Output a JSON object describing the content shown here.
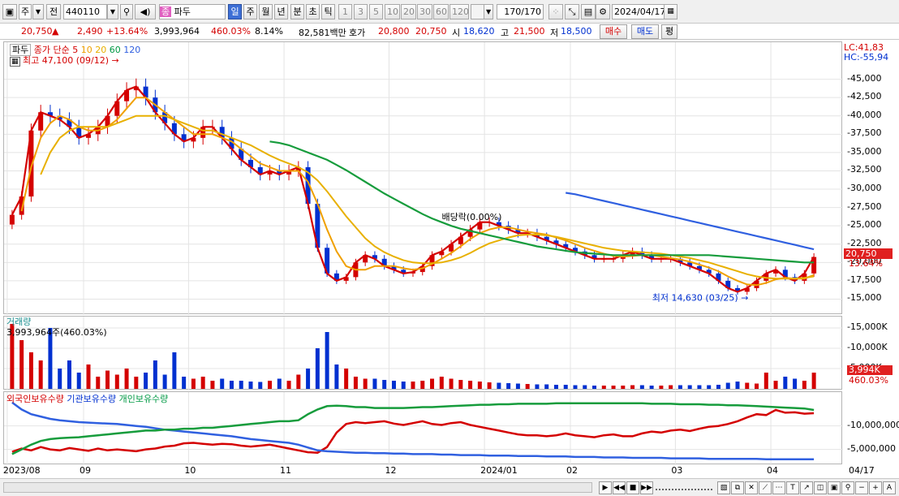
{
  "toolbar": {
    "period_main": "주",
    "prev_label": "전",
    "code": "440110",
    "type_badge": "종",
    "name": "파두",
    "periods": [
      "일",
      "주",
      "월",
      "년",
      "분",
      "초",
      "틱"
    ],
    "active_period": "일",
    "intervals": [
      "1",
      "3",
      "5",
      "10",
      "20",
      "30",
      "60",
      "120"
    ],
    "count": "170",
    "count_total": "/170",
    "date": "2024/04/17"
  },
  "quote": {
    "price": "20,750",
    "change_arrow": "▲",
    "change": "2,490",
    "change_pct": "+13.64%",
    "volume": "3,993,964",
    "volume_ratio": "460.03%",
    "turnover": "8.14%",
    "amount": "82,581백만",
    "ask_label": "호가",
    "ask": "20,800",
    "bid": "20,750",
    "open_label": "시",
    "open": "18,620",
    "high_label": "고",
    "high": "21,500",
    "low_label": "저",
    "low": "18,500",
    "buy_label": "매수",
    "sell_label": "매도",
    "eval_label": "평"
  },
  "colors": {
    "up": "#d40000",
    "down": "#0030d0",
    "ma5": "#d40000",
    "ma10": "#f0a000",
    "ma20": "#e8b000",
    "ma60": "#169c3c",
    "ma120": "#3060e0"
  },
  "chart_data": [
    {
      "type": "candlestick",
      "title": "파두",
      "legend": [
        "종가 단순 5",
        "10",
        "20",
        "60",
        "120"
      ],
      "y_ticks": [
        45000,
        42500,
        40000,
        37500,
        35000,
        32500,
        30000,
        27500,
        25000,
        22500,
        20000,
        17500,
        15000
      ],
      "ylim": [
        13500,
        48500
      ],
      "y_tick_labels": [
        "45,000",
        "42,500",
        "40,000",
        "37,500",
        "35,000",
        "32,500",
        "30,000",
        "27,500",
        "25,000",
        "22,500",
        "20,000",
        "17,500",
        "15,000"
      ],
      "annotations": {
        "high": "최고 47,100 (09/12)",
        "low": "최저 14,630 (03/25)",
        "dividend": "배당락(0.00%)",
        "lc": "LC:41,83",
        "hc": "HC:-55,94",
        "last_price": "20,750",
        "last_pct": "13.64%"
      },
      "series": [
        {
          "name": "5",
          "values": [
            26500,
            29000,
            38000,
            40500,
            40000,
            39500,
            38500,
            37000,
            37500,
            38500,
            40000,
            42000,
            43500,
            44000,
            42500,
            40500,
            39000,
            37500,
            36500,
            37000,
            38500,
            38500,
            37000,
            35500,
            34000,
            33000,
            32000,
            32500,
            32000,
            32500,
            33000,
            28000,
            22000,
            18500,
            17500,
            18000,
            20000,
            21000,
            20500,
            19500,
            19000,
            18500,
            18700,
            19500,
            21000,
            21500,
            22500,
            23500,
            24500,
            25500,
            25500,
            25000,
            24500,
            24000,
            24000,
            23500,
            23000,
            22500,
            22000,
            21500,
            21000,
            20500,
            20500,
            20500,
            21000,
            21500,
            21000,
            20500,
            20500,
            20500,
            20000,
            19500,
            19000,
            18500,
            17500,
            16500,
            16000,
            16500,
            17500,
            18500,
            19000,
            18000,
            17500,
            18500,
            20750
          ]
        },
        {
          "name": "10",
          "values": [
            null,
            27000,
            33000,
            37000,
            39000,
            40000,
            39500,
            38500,
            38000,
            38000,
            38500,
            39500,
            41000,
            42500,
            42500,
            41500,
            40500,
            39500,
            38500,
            37500,
            37500,
            37500,
            37000,
            36500,
            35500,
            34500,
            33500,
            33000,
            32500,
            32500,
            32500,
            31000,
            28000,
            24500,
            21500,
            19500,
            19000,
            19000,
            19500,
            19500,
            19500,
            19200,
            19000,
            19200,
            19800,
            20500,
            21300,
            22200,
            23200,
            24000,
            24500,
            24800,
            24800,
            24500,
            24200,
            24000,
            23800,
            23400,
            23000,
            22500,
            22000,
            21600,
            21200,
            20900,
            20800,
            20900,
            21000,
            21000,
            20800,
            20600,
            20400,
            20100,
            19700,
            19300,
            18800,
            18100,
            17500,
            17000,
            16900,
            17200,
            17700,
            17900,
            17800,
            17800,
            18300
          ]
        },
        {
          "name": "20",
          "values": [
            null,
            null,
            null,
            32000,
            35000,
            37000,
            38000,
            38500,
            38500,
            38500,
            38500,
            39000,
            39500,
            40000,
            40000,
            40000,
            40000,
            39500,
            39000,
            38500,
            38000,
            38000,
            37500,
            37000,
            36500,
            36000,
            35300,
            34600,
            34000,
            33500,
            33000,
            32300,
            31200,
            29700,
            28000,
            26300,
            24800,
            23300,
            22200,
            21400,
            20800,
            20300,
            20000,
            19900,
            19900,
            20000,
            20300,
            20700,
            21300,
            22000,
            22600,
            23000,
            23400,
            23700,
            23800,
            23800,
            23700,
            23500,
            23200,
            22900,
            22600,
            22300,
            22000,
            21800,
            21600,
            21500,
            21400,
            21300,
            21200,
            21000,
            20800,
            20600,
            20300,
            20000,
            19600,
            19200,
            18800,
            18400,
            18100,
            17900,
            17800,
            17800,
            17800,
            17900,
            18100
          ]
        },
        {
          "name": "60",
          "values": [
            null,
            null,
            null,
            null,
            null,
            null,
            null,
            null,
            null,
            null,
            null,
            null,
            null,
            null,
            null,
            null,
            null,
            null,
            null,
            null,
            null,
            null,
            null,
            null,
            null,
            null,
            null,
            36500,
            36300,
            36000,
            35500,
            35000,
            34500,
            34000,
            33300,
            32600,
            31800,
            31000,
            30200,
            29400,
            28700,
            28000,
            27300,
            26600,
            26000,
            25500,
            25000,
            24600,
            24300,
            24000,
            23700,
            23400,
            23100,
            22800,
            22500,
            22200,
            22000,
            21800,
            21600,
            21400,
            21300,
            21200,
            21100,
            21000,
            21000,
            21000,
            21000,
            21000,
            21000,
            21000,
            21000,
            21000,
            21000,
            21000,
            20900,
            20800,
            20700,
            20600,
            20500,
            20400,
            20300,
            20200,
            20100,
            20000,
            20000
          ]
        },
        {
          "name": "120",
          "values": [
            null,
            null,
            null,
            null,
            null,
            null,
            null,
            null,
            null,
            null,
            null,
            null,
            null,
            null,
            null,
            null,
            null,
            null,
            null,
            null,
            null,
            null,
            null,
            null,
            null,
            null,
            null,
            null,
            null,
            null,
            null,
            null,
            null,
            null,
            null,
            null,
            null,
            null,
            null,
            null,
            null,
            null,
            null,
            null,
            null,
            null,
            null,
            null,
            null,
            null,
            null,
            null,
            null,
            null,
            null,
            null,
            null,
            null,
            29500,
            29300,
            29000,
            28700,
            28400,
            28100,
            27800,
            27500,
            27200,
            26900,
            26600,
            26300,
            26000,
            25700,
            25400,
            25100,
            24800,
            24500,
            24200,
            23900,
            23600,
            23300,
            23000,
            22700,
            22400,
            22100,
            21800
          ]
        }
      ]
    },
    {
      "type": "bar",
      "title": "거래량",
      "readout": "3,993,964주(460.03%)",
      "y_tick_labels": [
        "15,000K",
        "10,000K",
        "5,000K"
      ],
      "y_ticks": [
        15000,
        10000,
        5000
      ],
      "ylim": [
        0,
        17000
      ],
      "last_value_label": "3,994K",
      "last_pct_label": "460.03%",
      "values": [
        16000,
        12000,
        9000,
        7000,
        15000,
        5000,
        7000,
        4000,
        6000,
        3000,
        4500,
        3500,
        5000,
        3000,
        4000,
        7000,
        3500,
        9000,
        3000,
        2500,
        3000,
        2000,
        2500,
        2000,
        2000,
        1800,
        1700,
        2000,
        2500,
        2000,
        3500,
        5000,
        10000,
        14000,
        6000,
        5000,
        3000,
        2500,
        2500,
        2200,
        2000,
        1800,
        1800,
        2000,
        2500,
        3000,
        2500,
        2200,
        2000,
        1800,
        1600,
        1500,
        1400,
        1300,
        1200,
        1100,
        1100,
        1000,
        1000,
        900,
        900,
        800,
        800,
        800,
        800,
        900,
        900,
        800,
        800,
        900,
        900,
        900,
        900,
        900,
        1000,
        1500,
        1800,
        1500,
        1300,
        4000,
        2000,
        3000,
        2500,
        2000,
        3994
      ]
    },
    {
      "type": "line",
      "legend": [
        "외국인보유수량",
        "기관보유수량",
        "개인보유수량"
      ],
      "y_tick_labels": [
        "10,000,000",
        "5,000,000"
      ],
      "y_ticks": [
        10000000,
        5000000
      ],
      "ylim": [
        2000000,
        16500000
      ],
      "series": [
        {
          "name": "외국인보유수량",
          "values": [
            4500000,
            5200000,
            4800000,
            5500000,
            5000000,
            4800000,
            5300000,
            5000000,
            4700000,
            5200000,
            4800000,
            5000000,
            4800000,
            4600000,
            5000000,
            5200000,
            5600000,
            5800000,
            6300000,
            6400000,
            6200000,
            6000000,
            6200000,
            6100000,
            5800000,
            5600000,
            5800000,
            6000000,
            5600000,
            5200000,
            4800000,
            4400000,
            4300000,
            5500000,
            8600000,
            10400000,
            10800000,
            10600000,
            10800000,
            11000000,
            10500000,
            10200000,
            10600000,
            11000000,
            10400000,
            10200000,
            10600000,
            10800000,
            10200000,
            9800000,
            9400000,
            9000000,
            8600000,
            8200000,
            8000000,
            8000000,
            7800000,
            8000000,
            8400000,
            8000000,
            7800000,
            7600000,
            8000000,
            8200000,
            7800000,
            7800000,
            8400000,
            8800000,
            8600000,
            9000000,
            9200000,
            8900000,
            9400000,
            9800000,
            10000000,
            10400000,
            11000000,
            11800000,
            12500000,
            12300000,
            13400000,
            12800000,
            12900000,
            12600000,
            12700000
          ]
        },
        {
          "name": "기관보유수량",
          "values": [
            15000000,
            13500000,
            12500000,
            12000000,
            11500000,
            11200000,
            11000000,
            10800000,
            10700000,
            10600000,
            10500000,
            10400000,
            10200000,
            10000000,
            9800000,
            9500000,
            9200000,
            9000000,
            8800000,
            8600000,
            8400000,
            8200000,
            8000000,
            7800000,
            7500000,
            7200000,
            7000000,
            6800000,
            6600000,
            6400000,
            6000000,
            5400000,
            4800000,
            4600000,
            4500000,
            4400000,
            4300000,
            4300000,
            4200000,
            4200000,
            4100000,
            4100000,
            4000000,
            4000000,
            4000000,
            3900000,
            3900000,
            3800000,
            3800000,
            3800000,
            3700000,
            3700000,
            3700000,
            3600000,
            3600000,
            3600000,
            3500000,
            3500000,
            3500000,
            3400000,
            3400000,
            3400000,
            3300000,
            3300000,
            3300000,
            3200000,
            3200000,
            3200000,
            3200000,
            3100000,
            3100000,
            3100000,
            3100000,
            3000000,
            3000000,
            3000000,
            3000000,
            3000000,
            3000000,
            2900000,
            2900000,
            2900000,
            2900000,
            2900000,
            2900000
          ]
        },
        {
          "name": "개인보유수량",
          "values": [
            4000000,
            5000000,
            6000000,
            6800000,
            7200000,
            7400000,
            7500000,
            7600000,
            7800000,
            8000000,
            8200000,
            8400000,
            8600000,
            8800000,
            9000000,
            9000000,
            9200000,
            9200000,
            9400000,
            9400000,
            9600000,
            9600000,
            9800000,
            10000000,
            10200000,
            10400000,
            10600000,
            10800000,
            11000000,
            11000000,
            11200000,
            12500000,
            13500000,
            14200000,
            14300000,
            14200000,
            14000000,
            14000000,
            13800000,
            13800000,
            13800000,
            13800000,
            13900000,
            14000000,
            14000000,
            14100000,
            14200000,
            14300000,
            14400000,
            14500000,
            14500000,
            14600000,
            14600000,
            14700000,
            14700000,
            14700000,
            14700000,
            14800000,
            14800000,
            14800000,
            14800000,
            14800000,
            14800000,
            14800000,
            14800000,
            14800000,
            14800000,
            14700000,
            14700000,
            14700000,
            14600000,
            14600000,
            14600000,
            14500000,
            14500000,
            14400000,
            14400000,
            14300000,
            14200000,
            14100000,
            14000000,
            13900000,
            13800000,
            13700000,
            13400000
          ]
        }
      ]
    }
  ],
  "x_axis": {
    "labels": [
      "2023/08",
      "09",
      "10",
      "11",
      "12",
      "2024/01",
      "02",
      "03",
      "04",
      "04/17"
    ]
  }
}
